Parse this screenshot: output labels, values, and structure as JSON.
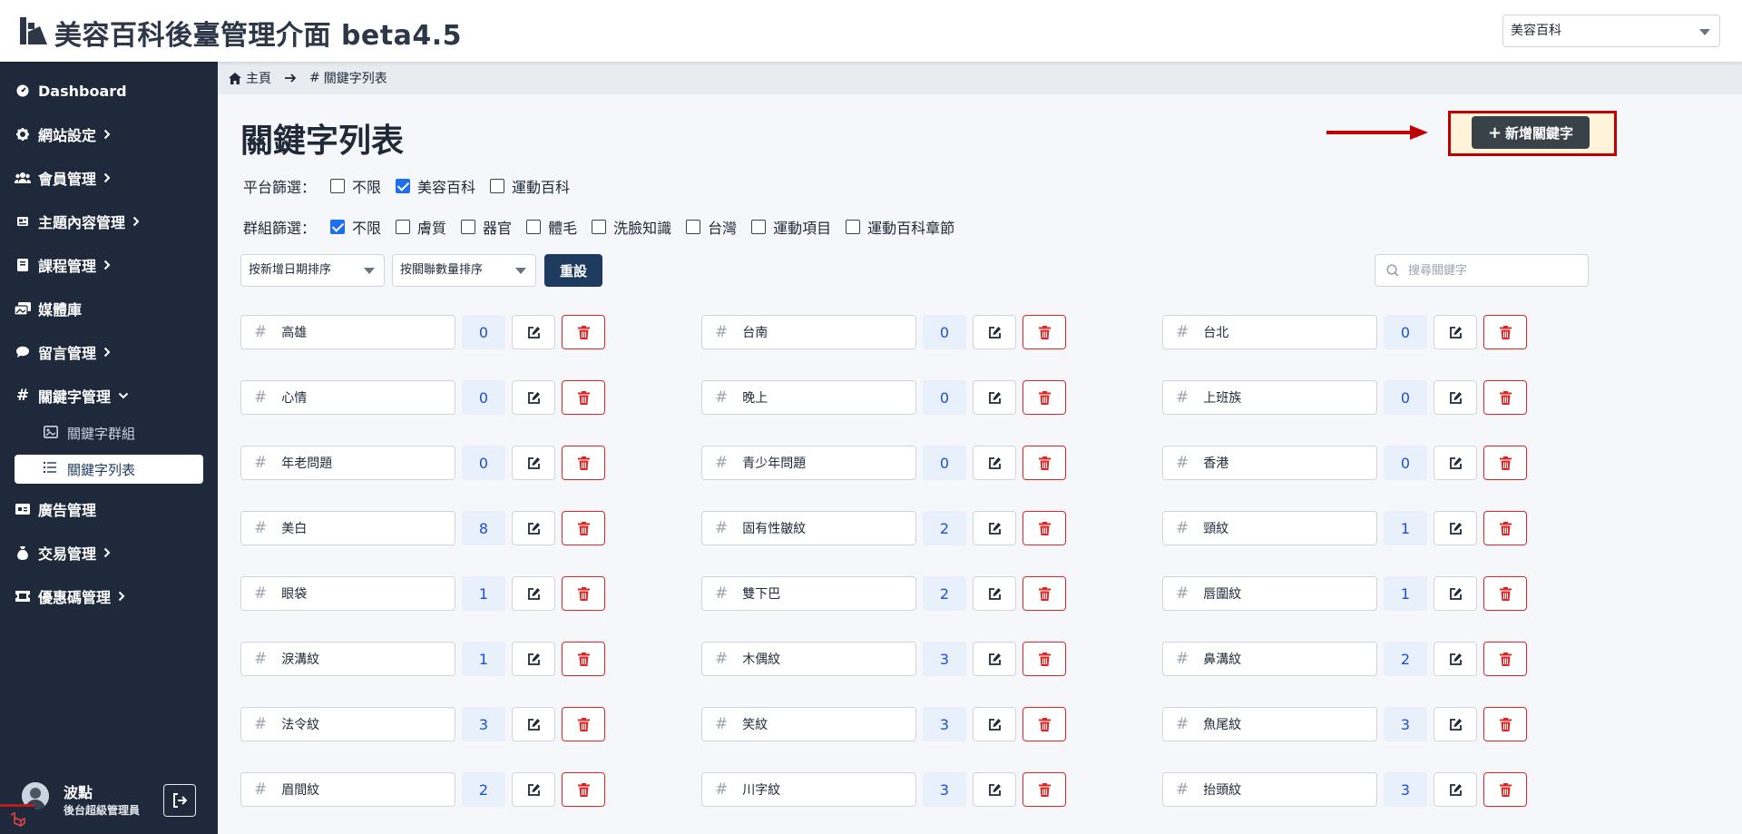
{
  "app": {
    "title": "美容百科後臺管理介面 beta4.5",
    "platform_selected": "美容百科"
  },
  "sidebar": {
    "items": [
      {
        "label": "Dashboard",
        "icon": "dashboard-icon"
      },
      {
        "label": "網站設定",
        "icon": "gear-icon"
      },
      {
        "label": "會員管理",
        "icon": "users-icon"
      },
      {
        "label": "主題內容管理",
        "icon": "content-icon"
      },
      {
        "label": "課程管理",
        "icon": "book-icon"
      },
      {
        "label": "媒體庫",
        "icon": "images-icon"
      },
      {
        "label": "留言管理",
        "icon": "comment-icon"
      },
      {
        "label": "關鍵字管理",
        "icon": "hash-icon"
      },
      {
        "label": "廣告管理",
        "icon": "ad-icon"
      },
      {
        "label": "交易管理",
        "icon": "money-bag-icon"
      },
      {
        "label": "優惠碼管理",
        "icon": "ticket-icon"
      }
    ],
    "sub_items": [
      "關鍵字群組",
      "關鍵字列表"
    ],
    "user": {
      "name": "波點",
      "role": "後台超級管理員"
    }
  },
  "breadcrumb": {
    "home": "主頁",
    "current": "關鍵字列表"
  },
  "page": {
    "title": "關鍵字列表",
    "add_button": "新增關鍵字"
  },
  "filters": {
    "platform_label": "平台篩選：",
    "platform_options": [
      {
        "label": "不限",
        "checked": false
      },
      {
        "label": "美容百科",
        "checked": true
      },
      {
        "label": "運動百科",
        "checked": false
      }
    ],
    "group_label": "群組篩選：",
    "group_options": [
      {
        "label": "不限",
        "checked": true
      },
      {
        "label": "膚質",
        "checked": false
      },
      {
        "label": "器官",
        "checked": false
      },
      {
        "label": "體毛",
        "checked": false
      },
      {
        "label": "洗臉知識",
        "checked": false
      },
      {
        "label": "台灣",
        "checked": false
      },
      {
        "label": "運動項目",
        "checked": false
      },
      {
        "label": "運動百科章節",
        "checked": false
      }
    ]
  },
  "toolbar": {
    "sort_date": "按新增日期排序",
    "sort_count": "按關聯數量排序",
    "reset": "重設",
    "search_placeholder": "搜尋關鍵字"
  },
  "keywords": [
    {
      "name": "高雄",
      "count": "0"
    },
    {
      "name": "台南",
      "count": "0"
    },
    {
      "name": "台北",
      "count": "0"
    },
    {
      "name": "心情",
      "count": "0"
    },
    {
      "name": "晚上",
      "count": "0"
    },
    {
      "name": "上班族",
      "count": "0"
    },
    {
      "name": "年老問題",
      "count": "0"
    },
    {
      "name": "青少年問題",
      "count": "0"
    },
    {
      "name": "香港",
      "count": "0"
    },
    {
      "name": "美白",
      "count": "8"
    },
    {
      "name": "固有性皺紋",
      "count": "2"
    },
    {
      "name": "頸紋",
      "count": "1"
    },
    {
      "name": "眼袋",
      "count": "1"
    },
    {
      "name": "雙下巴",
      "count": "2"
    },
    {
      "name": "唇圍紋",
      "count": "1"
    },
    {
      "name": "淚溝紋",
      "count": "1"
    },
    {
      "name": "木偶紋",
      "count": "3"
    },
    {
      "name": "鼻溝紋",
      "count": "2"
    },
    {
      "name": "法令紋",
      "count": "3"
    },
    {
      "name": "笑紋",
      "count": "3"
    },
    {
      "name": "魚尾紋",
      "count": "3"
    },
    {
      "name": "眉間紋",
      "count": "2"
    },
    {
      "name": "川字紋",
      "count": "3"
    },
    {
      "name": "抬頭紋",
      "count": "3"
    }
  ]
}
